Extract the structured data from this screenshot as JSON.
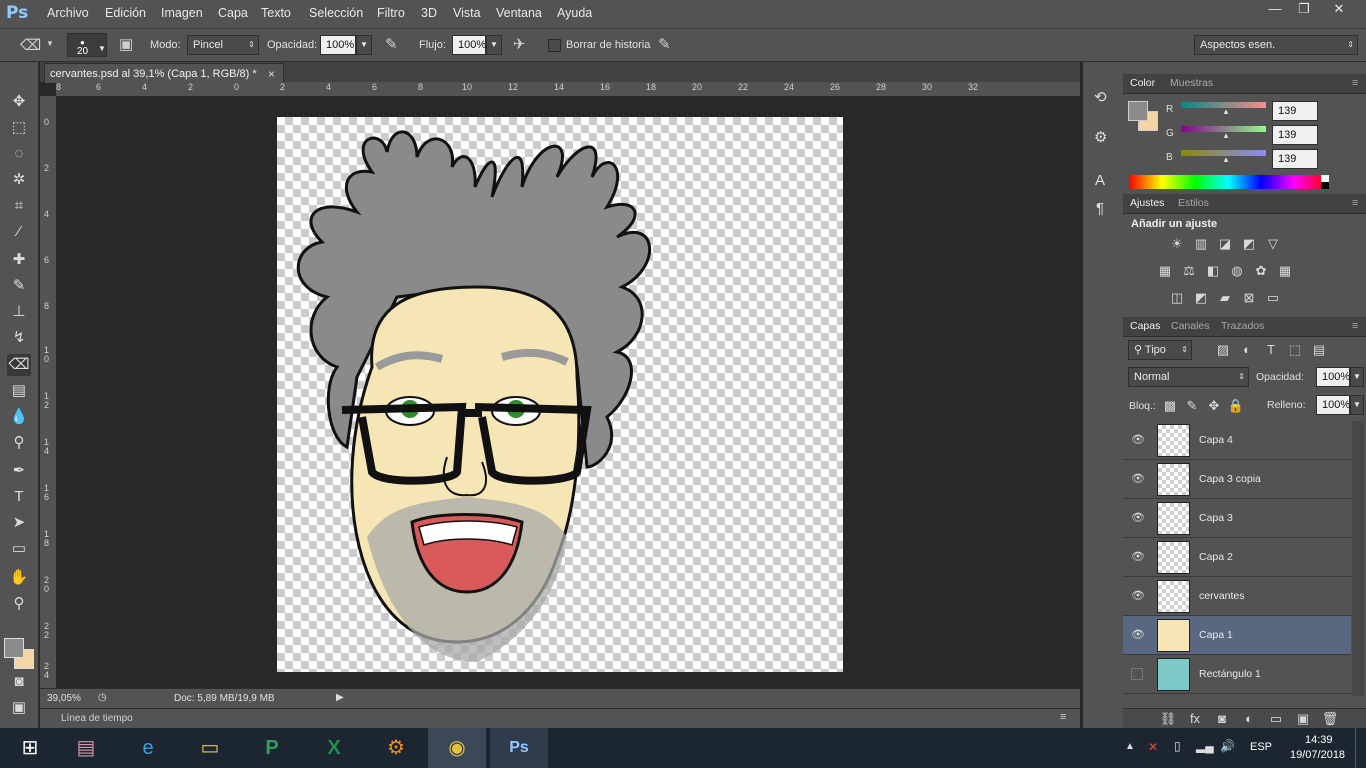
{
  "app": {
    "logo": "Ps"
  },
  "menu": [
    "Archivo",
    "Edición",
    "Imagen",
    "Capa",
    "Texto",
    "Selección",
    "Filtro",
    "3D",
    "Vista",
    "Ventana",
    "Ayuda"
  ],
  "window_controls": {
    "minimize": "—",
    "restore": "❐",
    "close": "✕"
  },
  "options": {
    "brush_size": "20",
    "mode_label": "Modo:",
    "mode_value": "Pincel",
    "opacity_label": "Opacidad:",
    "opacity_value": "100%",
    "flow_label": "Flujo:",
    "flow_value": "100%",
    "history_label": "Borrar de historia",
    "workspace": "Aspectos esen."
  },
  "document": {
    "tab_title": "cervantes.psd al 39,1% (Capa 1, RGB/8) *",
    "tab_close": "×",
    "zoom": "39,05%",
    "doc_info": "Doc: 5,89 MB/19,9 MB",
    "timeline_label": "Línea de tiempo"
  },
  "ruler_top": [
    "8",
    "6",
    "4",
    "2",
    "0",
    "2",
    "4",
    "6",
    "8",
    "10",
    "12",
    "14",
    "16",
    "18",
    "20",
    "22",
    "24",
    "26",
    "28",
    "30",
    "32"
  ],
  "ruler_left": [
    "0",
    "2",
    "4",
    "6",
    "8",
    "1\n0",
    "1\n2",
    "1\n4",
    "1\n6",
    "1\n8",
    "2\n0",
    "2\n2",
    "2\n4"
  ],
  "color_panel": {
    "tabs": [
      "Color",
      "Muestras"
    ],
    "r_label": "R",
    "g_label": "G",
    "b_label": "B",
    "r": "139",
    "g": "139",
    "b": "139",
    "foreground": "#8b8b8b",
    "background": "#f4d6a6"
  },
  "adjust_panel": {
    "tabs": [
      "Ajustes",
      "Estilos"
    ],
    "heading": "Añadir un ajuste"
  },
  "layers_panel": {
    "tabs": [
      "Capas",
      "Canales",
      "Trazados"
    ],
    "filter": "Tipo",
    "blend": "Normal",
    "opacity_label": "Opacidad:",
    "opacity": "100%",
    "lock_label": "Bloq.:",
    "fill_label": "Relleno:",
    "fill": "100%",
    "layers": [
      {
        "name": "Capa 4",
        "visible": true,
        "selected": false
      },
      {
        "name": "Capa 3 copia",
        "visible": true,
        "selected": false
      },
      {
        "name": "Capa 3",
        "visible": true,
        "selected": false
      },
      {
        "name": "Capa 2",
        "visible": true,
        "selected": false
      },
      {
        "name": "cervantes",
        "visible": true,
        "selected": false
      },
      {
        "name": "Capa 1",
        "visible": true,
        "selected": true
      },
      {
        "name": "Rectángulo 1",
        "visible": false,
        "selected": false
      }
    ]
  },
  "taskbar": {
    "language": "ESP",
    "time": "14:39",
    "date": "19/07/2018"
  },
  "colors": {
    "chrome": "#535353",
    "canvas_bg": "#282828",
    "selected_layer": "#596780",
    "taskbar": "#1c2630",
    "skin": "#f7e6b5",
    "hair": "#8a8a8a",
    "eye": "#2e8b2e",
    "mouth": "#d95a5a",
    "rect_layer": "#7ec8c8"
  }
}
